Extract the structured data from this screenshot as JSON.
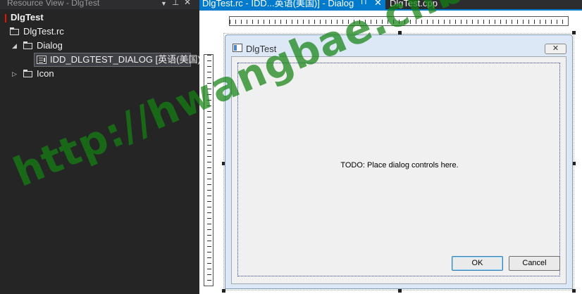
{
  "resource_view": {
    "title": "Resource View - DlgTest",
    "dropdown_glyph": "▼",
    "pin_glyph": "⊥",
    "close_glyph": "✕",
    "tree": {
      "root": "DlgTest",
      "rc_file": "DlgTest.rc",
      "dialog_folder": "Dialog",
      "dialog_resource": "IDD_DLGTEST_DIALOG [英语(美国)]",
      "icon_folder": "Icon",
      "expanded_glyph": "◢",
      "collapsed_glyph": "▷"
    }
  },
  "tabs": [
    {
      "label": "DlgTest.rc - IDD...英语(美国)] - Dialog",
      "pin_glyph": "⊓",
      "close_glyph": "✕",
      "active": true
    },
    {
      "label": "DlgTest.cpp",
      "active": false
    }
  ],
  "dialog": {
    "title": "DlgTest",
    "close_glyph": "✕",
    "todo_text": "TODO: Place dialog controls here.",
    "ok_label": "OK",
    "cancel_label": "Cancel"
  },
  "watermark": "http://hwangbae.cnblogs.com/",
  "colors": {
    "accent": "#007acc",
    "panel_bg": "#252526",
    "watermark": "#148214"
  }
}
